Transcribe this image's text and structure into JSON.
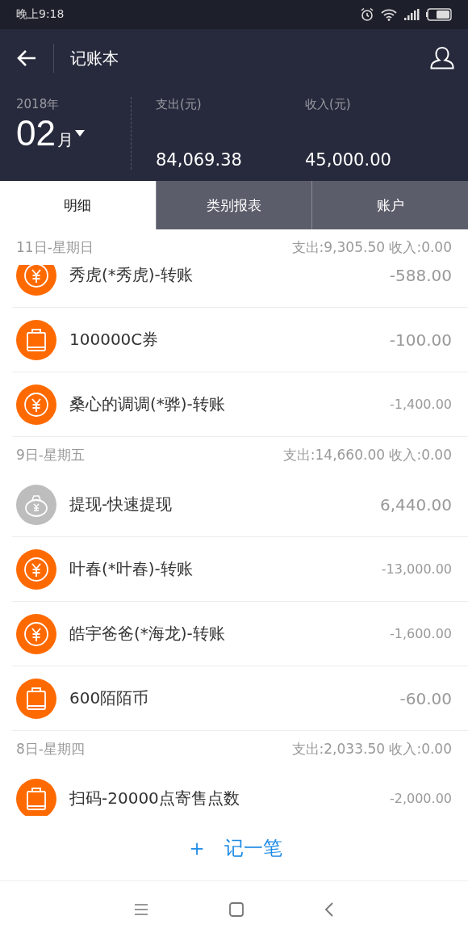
{
  "status_bar": {
    "time": "晚上9:18"
  },
  "toolbar": {
    "title": "记账本"
  },
  "summary": {
    "year": "2018年",
    "month": "02",
    "month_unit": "月",
    "expense_label": "支出(元)",
    "expense": "84,069.38",
    "income_label": "收入(元)",
    "income": "45,000.00"
  },
  "tabs": [
    {
      "label": "明细",
      "selected": true
    },
    {
      "label": "类别报表",
      "selected": false
    },
    {
      "label": "账户",
      "selected": false
    }
  ],
  "groups": [
    {
      "date": "11日-星期日",
      "totals": "支出:9,305.50 收入:0.00",
      "items": [
        {
          "kind": "transfer",
          "title": "秀虎(*秀虎)-转账",
          "amount": "-588.00"
        },
        {
          "kind": "shopping",
          "title": "100000C券",
          "amount": "-100.00"
        },
        {
          "kind": "transfer",
          "title": "桑心的调调(*骅)-转账",
          "amount": "-1,400.00"
        }
      ]
    },
    {
      "date": "9日-星期五",
      "totals": "支出:14,660.00 收入:0.00",
      "items": [
        {
          "kind": "withdraw",
          "title": "提现-快速提现",
          "amount": "6,440.00"
        },
        {
          "kind": "transfer",
          "title": "叶春(*叶春)-转账",
          "amount": "-13,000.00"
        },
        {
          "kind": "transfer",
          "title": "皓宇爸爸(*海龙)-转账",
          "amount": "-1,600.00"
        },
        {
          "kind": "shopping",
          "title": "600陌陌币",
          "amount": "-60.00"
        }
      ]
    },
    {
      "date": "8日-星期四",
      "totals": "支出:2,033.50 收入:0.00",
      "items": [
        {
          "kind": "shopping",
          "title": "扫码-20000点寄售点数",
          "amount": "-2,000.00"
        }
      ]
    }
  ],
  "add_button": {
    "icon": "＋",
    "label": "记一笔"
  }
}
